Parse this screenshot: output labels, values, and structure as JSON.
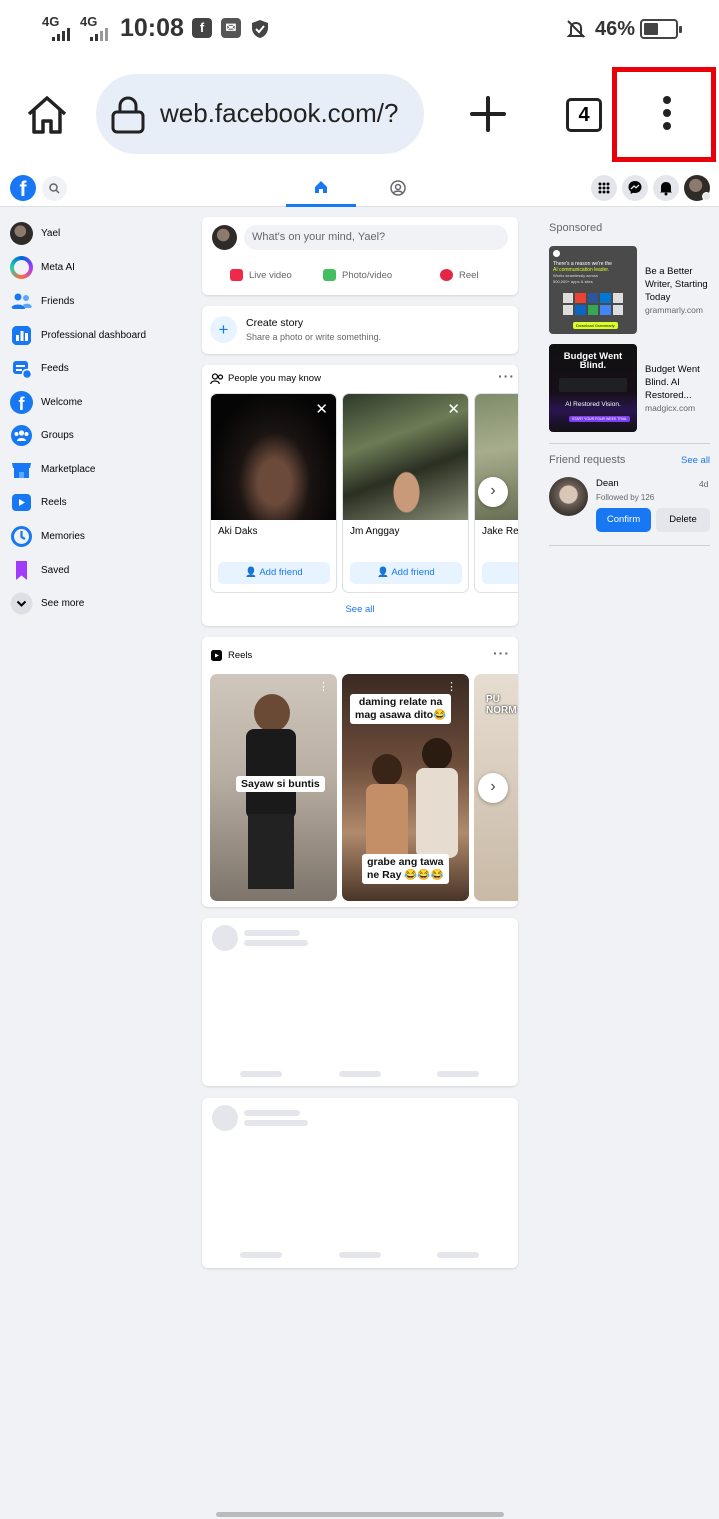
{
  "status_bar": {
    "network1": "4G",
    "network2": "4G",
    "time": "10:08",
    "battery_pct": "46%",
    "battery_level": 0.46
  },
  "browser": {
    "url": "web.facebook.com/?",
    "tab_count": "4"
  },
  "sidebar": {
    "items": [
      {
        "label": "Yael",
        "icon": "profile-avatar"
      },
      {
        "label": "Meta AI",
        "icon": "meta-ai-icon"
      },
      {
        "label": "Friends",
        "icon": "friends-icon"
      },
      {
        "label": "Professional dashboard",
        "icon": "dashboard-icon"
      },
      {
        "label": "Feeds",
        "icon": "feeds-icon"
      },
      {
        "label": "Welcome",
        "icon": "facebook-icon"
      },
      {
        "label": "Groups",
        "icon": "groups-icon"
      },
      {
        "label": "Marketplace",
        "icon": "marketplace-icon"
      },
      {
        "label": "Reels",
        "icon": "reels-icon"
      },
      {
        "label": "Memories",
        "icon": "memories-icon"
      },
      {
        "label": "Saved",
        "icon": "saved-icon"
      },
      {
        "label": "See more",
        "icon": "chevron-down-icon"
      }
    ]
  },
  "composer": {
    "placeholder": "What's on your mind, Yael?",
    "actions": [
      "Live video",
      "Photo/video",
      "Reel"
    ]
  },
  "story": {
    "title": "Create story",
    "subtitle": "Share a photo or write something."
  },
  "people_you_may_know": {
    "title": "People you may know",
    "people": [
      {
        "name": "Aki Daks",
        "action": "Add friend"
      },
      {
        "name": "Jm Anggay",
        "action": "Add friend"
      },
      {
        "name": "Jake Re",
        "action": ""
      }
    ],
    "see_all": "See all"
  },
  "reels": {
    "title": "Reels",
    "items": [
      {
        "caption": "Sayaw si buntis"
      },
      {
        "caption_top": "daming relate na",
        "caption_top2": "mag asawa dito😂",
        "caption_bottom": "grabe ang tawa",
        "caption_bottom2": "ne Ray 😂😂😂"
      },
      {
        "caption_top": "PU",
        "caption_top2": "NORM"
      }
    ]
  },
  "right": {
    "sponsored": "Sponsored",
    "ads": [
      {
        "title": "Be a Better Writer, Starting Today",
        "source": "grammarly.com",
        "img_line1": "There's a reason we're the",
        "img_line2": "AI communication leader.",
        "img_line3": "Works seamlessly across",
        "img_line4": "500,000+ apps & sites",
        "img_btn": "Download Grammarly"
      },
      {
        "title": "Budget Went Blind. AI Restored...",
        "source": "madgicx.com",
        "img_title": "Budget Went Blind.",
        "img_sub": "AI Restored Vision.",
        "img_btn": "START YOUR FOUR WEEK TRIAL"
      }
    ],
    "friend_requests": {
      "title": "Friend requests",
      "see_all": "See all",
      "name": "Dean",
      "time": "4d",
      "mutual": "Followed by 126",
      "confirm": "Confirm",
      "delete": "Delete"
    }
  }
}
